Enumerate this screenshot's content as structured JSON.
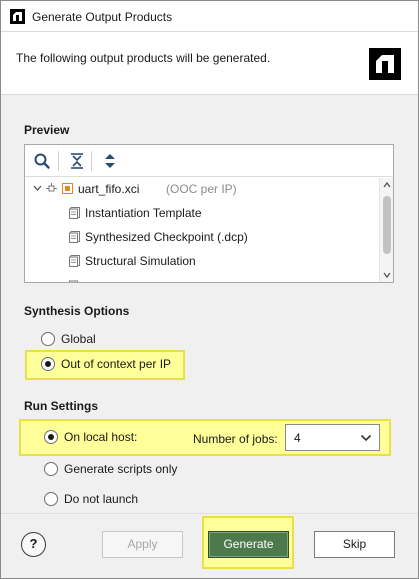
{
  "window": {
    "title": "Generate Output Products"
  },
  "header": {
    "message": "The following output products will be generated."
  },
  "preview": {
    "label": "Preview",
    "toolbar": {
      "search_icon": "search-icon",
      "collapse_icon": "collapse-all-icon",
      "expand_icon": "expand-all-icon"
    },
    "tree": {
      "root": {
        "name": "uart_fifo.xci",
        "suffix": "(OOC per IP)"
      },
      "children": [
        "Instantiation Template",
        "Synthesized Checkpoint (.dcp)",
        "Structural Simulation"
      ]
    }
  },
  "synthesis": {
    "label": "Synthesis Options",
    "global_label": "Global",
    "ooc_label": "Out of context per IP",
    "selected": "ooc"
  },
  "run": {
    "label": "Run Settings",
    "local_label": "On local host:",
    "jobs_label": "Number of jobs:",
    "jobs_value": "4",
    "scripts_label": "Generate scripts only",
    "no_launch_label": "Do not launch",
    "selected": "local"
  },
  "footer": {
    "help_label": "?",
    "apply_label": "Apply",
    "generate_label": "Generate",
    "skip_label": "Skip"
  },
  "colors": {
    "highlight": "#ffff9a",
    "primary_button": "#4d7a4d",
    "brand": "#000000"
  }
}
